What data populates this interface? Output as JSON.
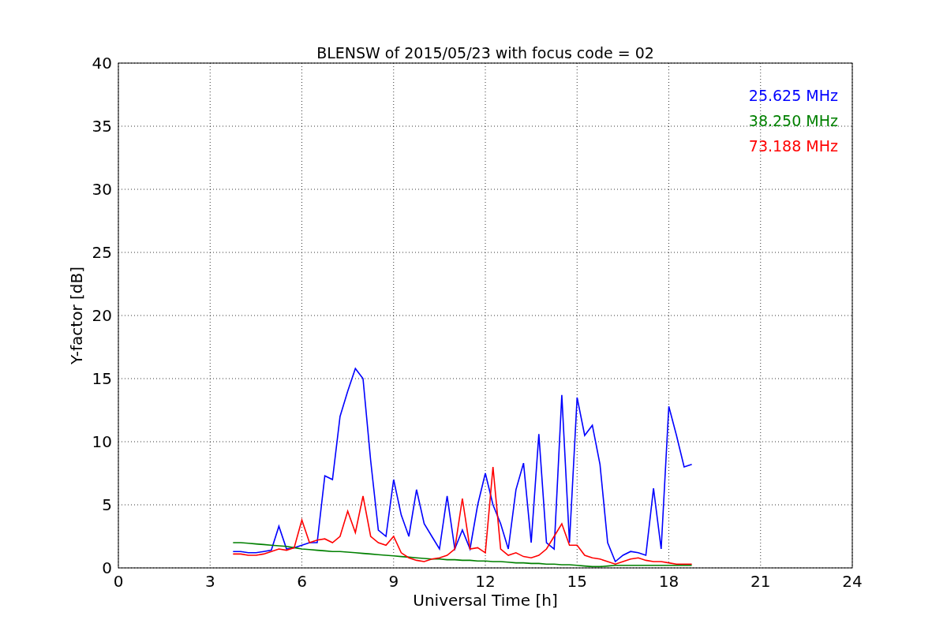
{
  "chart_data": {
    "type": "line",
    "title": "BLENSW of 2015/05/23 with focus code = 02",
    "xlabel": "Universal Time [h]",
    "ylabel": "Y-factor [dB]",
    "grid": true,
    "xlim": [
      0,
      24
    ],
    "ylim": [
      0,
      40
    ],
    "xticks": [
      0,
      3,
      6,
      9,
      12,
      15,
      18,
      21,
      24
    ],
    "yticks": [
      0,
      5,
      10,
      15,
      20,
      25,
      30,
      35,
      40
    ],
    "x": [
      3.75,
      4,
      4.25,
      4.5,
      4.75,
      5,
      5.25,
      5.5,
      5.75,
      6,
      6.25,
      6.5,
      6.75,
      7,
      7.25,
      7.5,
      7.75,
      8,
      8.25,
      8.5,
      8.75,
      9,
      9.25,
      9.5,
      9.75,
      10,
      10.25,
      10.5,
      10.75,
      11,
      11.25,
      11.5,
      11.75,
      12,
      12.25,
      12.5,
      12.75,
      13,
      13.25,
      13.5,
      13.75,
      14,
      14.25,
      14.5,
      14.75,
      15,
      15.25,
      15.5,
      15.75,
      16,
      16.25,
      16.5,
      16.75,
      17,
      17.25,
      17.5,
      17.75,
      18,
      18.25,
      18.5,
      18.75
    ],
    "series": [
      {
        "name": "25.625 MHz",
        "color": "#0000ff",
        "values": [
          1.3,
          1.3,
          1.2,
          1.2,
          1.3,
          1.4,
          3.3,
          1.5,
          1.6,
          1.8,
          2.0,
          2.0,
          7.3,
          7.0,
          12.0,
          14.0,
          15.8,
          15.0,
          8.5,
          3.0,
          2.5,
          7.0,
          4.2,
          2.5,
          6.2,
          3.5,
          2.5,
          1.5,
          5.7,
          1.5,
          3.0,
          1.5,
          5.0,
          7.5,
          5.0,
          3.5,
          1.5,
          6.2,
          8.3,
          2.0,
          10.6,
          2.0,
          1.5,
          13.7,
          2.0,
          13.5,
          10.5,
          11.3,
          8.2,
          2.0,
          0.5,
          1.0,
          1.3,
          1.2,
          1.0,
          6.3,
          1.5,
          12.8,
          10.5,
          8.0,
          8.2
        ]
      },
      {
        "name": "38.250 MHz",
        "color": "#008000",
        "values": [
          2.0,
          2.0,
          1.95,
          1.9,
          1.85,
          1.8,
          1.75,
          1.7,
          1.6,
          1.5,
          1.45,
          1.4,
          1.35,
          1.3,
          1.3,
          1.25,
          1.2,
          1.15,
          1.1,
          1.05,
          1.0,
          0.95,
          0.9,
          0.85,
          0.8,
          0.75,
          0.7,
          0.7,
          0.65,
          0.65,
          0.6,
          0.6,
          0.55,
          0.55,
          0.5,
          0.5,
          0.45,
          0.4,
          0.4,
          0.35,
          0.35,
          0.3,
          0.3,
          0.25,
          0.25,
          0.2,
          0.15,
          0.1,
          0.1,
          0.15,
          0.2,
          0.2,
          0.2,
          0.2,
          0.2,
          0.2,
          0.2,
          0.2,
          0.2,
          0.2,
          0.2
        ]
      },
      {
        "name": "73.188 MHz",
        "color": "#ff0000",
        "values": [
          1.1,
          1.1,
          1.0,
          1.0,
          1.1,
          1.3,
          1.5,
          1.4,
          1.6,
          3.8,
          2.0,
          2.2,
          2.3,
          2.0,
          2.5,
          4.5,
          2.8,
          5.7,
          2.5,
          2.0,
          1.8,
          2.5,
          1.2,
          0.8,
          0.6,
          0.5,
          0.7,
          0.8,
          1.0,
          1.5,
          5.5,
          1.5,
          1.6,
          1.2,
          8.0,
          1.5,
          1.0,
          1.2,
          0.9,
          0.8,
          1.0,
          1.5,
          2.5,
          3.5,
          1.8,
          1.8,
          1.0,
          0.8,
          0.7,
          0.5,
          0.3,
          0.5,
          0.7,
          0.8,
          0.6,
          0.5,
          0.5,
          0.4,
          0.3,
          0.3,
          0.3
        ]
      }
    ]
  }
}
